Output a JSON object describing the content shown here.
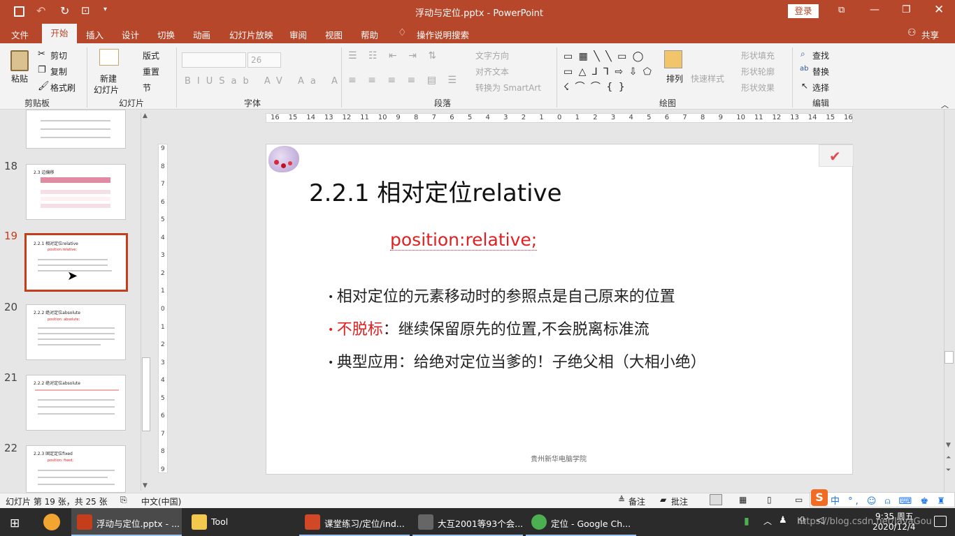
{
  "window": {
    "title": "浮动与定位.pptx - PowerPoint",
    "login": "登录"
  },
  "tabs": [
    "文件",
    "开始",
    "插入",
    "设计",
    "切换",
    "动画",
    "幻灯片放映",
    "审阅",
    "视图",
    "帮助"
  ],
  "tell_me": "操作说明搜索",
  "share": "共享",
  "ribbon": {
    "clipboard": {
      "paste": "粘贴",
      "cut": "剪切",
      "copy": "复制",
      "format_painter": "格式刷",
      "label": "剪贴板"
    },
    "slides": {
      "new_slide": "新建",
      "new_slide2": "幻灯片",
      "layout": "版式",
      "reset": "重置",
      "section": "节",
      "label": "幻灯片"
    },
    "font": {
      "size": "26",
      "label": "字体"
    },
    "paragraph": {
      "text_direction": "文字方向",
      "align_text": "对齐文本",
      "smartart": "转换为 SmartArt",
      "label": "段落"
    },
    "drawing": {
      "arrange": "排列",
      "quick_styles": "快速样式",
      "shape_fill": "形状填充",
      "shape_outline": "形状轮廓",
      "shape_effects": "形状效果",
      "label": "绘图"
    },
    "editing": {
      "find": "查找",
      "replace": "替换",
      "select": "选择",
      "label": "编辑"
    }
  },
  "ruler": {
    "h_ticks": [
      "16",
      "15",
      "14",
      "13",
      "12",
      "11",
      "10",
      "9",
      "8",
      "7",
      "6",
      "5",
      "4",
      "3",
      "2",
      "1",
      "0",
      "1",
      "2",
      "3",
      "4",
      "5",
      "6",
      "7",
      "8",
      "9",
      "10",
      "11",
      "12",
      "13",
      "14",
      "15",
      "16"
    ],
    "v_ticks": [
      "9",
      "8",
      "7",
      "6",
      "5",
      "4",
      "3",
      "2",
      "1",
      "0",
      "1",
      "2",
      "3",
      "4",
      "5",
      "6",
      "7",
      "8",
      "9"
    ]
  },
  "thumbnails": [
    {
      "num": "18",
      "title": "2.3 边偏移"
    },
    {
      "num": "19",
      "title": "2.2.1 相对定位relative",
      "sub": "position:relative;"
    },
    {
      "num": "20",
      "title": "2.2.2 绝对定位absolute",
      "sub": "position: absolute;"
    },
    {
      "num": "21",
      "title": "2.2.2 绝对定位absolute"
    },
    {
      "num": "22",
      "title": "2.2.3 固定定位fixed",
      "sub": "position: fixed;"
    }
  ],
  "slide": {
    "title": "2.2.1 相对定位relative",
    "code": "position:relative;",
    "bullets": [
      {
        "highlight": "",
        "text": "相对定位的元素移动时的参照点是自己原来的位置"
      },
      {
        "highlight": "不脱标",
        "text": "：继续保留原先的位置,不会脱离标准流"
      },
      {
        "highlight": "",
        "text": "典型应用：给绝对定位当爹的！子绝父相（大相小绝）"
      }
    ],
    "footer": "贵州新华电脑学院"
  },
  "status": {
    "slide_count": "幻灯片 第 19 张，共 25 张",
    "language": "中文(中国)",
    "notes": "备注",
    "comments": "批注"
  },
  "taskbar": {
    "items": [
      {
        "label": "浮动与定位.pptx - ...",
        "color": "#c43e1c"
      },
      {
        "label": "Tool",
        "color": "#f2c94c"
      },
      {
        "label": "课堂练习/定位/ind...",
        "color": "#d24726"
      },
      {
        "label": "大互2001等93个会...",
        "color": "#666"
      },
      {
        "label": "定位 - Google Ch...",
        "color": "#4caf50"
      }
    ],
    "time": "9:35 周五",
    "date": "2020/12/4",
    "watermark": "https://blog.csdn.net/JavaGou"
  },
  "colors": {
    "accent": "#b7472a",
    "red": "#e02020"
  }
}
